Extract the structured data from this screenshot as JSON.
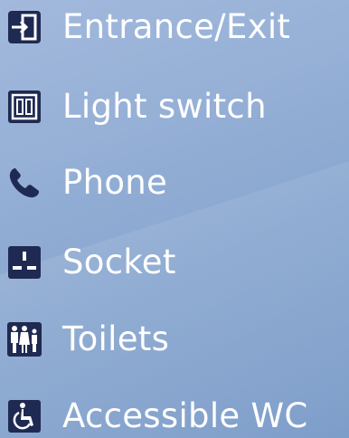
{
  "legend": {
    "items": [
      {
        "label": "Entrance/Exit",
        "icon": "entrance-exit-icon"
      },
      {
        "label": "Light switch",
        "icon": "light-switch-icon"
      },
      {
        "label": "Phone",
        "icon": "phone-icon"
      },
      {
        "label": "Socket",
        "icon": "socket-icon"
      },
      {
        "label": "Toilets",
        "icon": "toilets-icon"
      },
      {
        "label": "Accessible WC",
        "icon": "accessible-wc-icon"
      }
    ]
  },
  "colors": {
    "icon_fill": "#1f2a52",
    "text": "#ffffff",
    "background_top": "#a2b9dc",
    "background_bottom": "#7d9dc9"
  }
}
